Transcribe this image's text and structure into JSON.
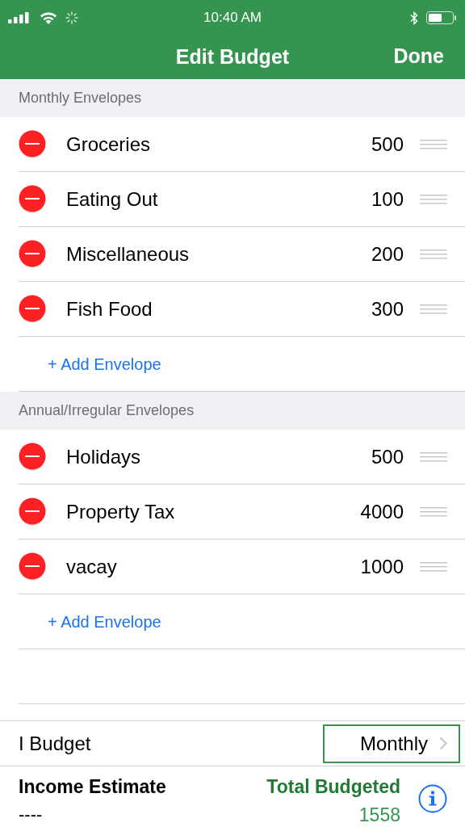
{
  "status_bar": {
    "time": "10:40 AM"
  },
  "nav_bar": {
    "title": "Edit Budget",
    "action": "Done"
  },
  "sections": [
    {
      "title": "Monthly Envelopes",
      "add_label": "+ Add Envelope",
      "envelopes": [
        {
          "name": "Groceries",
          "amount": "500"
        },
        {
          "name": "Eating Out",
          "amount": "100"
        },
        {
          "name": "Miscellaneous",
          "amount": "200"
        },
        {
          "name": "Fish Food",
          "amount": "300"
        }
      ]
    },
    {
      "title": "Annual/Irregular Envelopes",
      "add_label": "+ Add Envelope",
      "envelopes": [
        {
          "name": "Holidays",
          "amount": "500"
        },
        {
          "name": "Property Tax",
          "amount": "4000"
        },
        {
          "name": "vacay",
          "amount": "1000"
        }
      ]
    }
  ],
  "budget_period": {
    "label": "I Budget",
    "value": "Monthly"
  },
  "footer": {
    "income_label": "Income Estimate",
    "income_value": "----",
    "total_label": "Total Budgeted",
    "total_value": "1558"
  }
}
